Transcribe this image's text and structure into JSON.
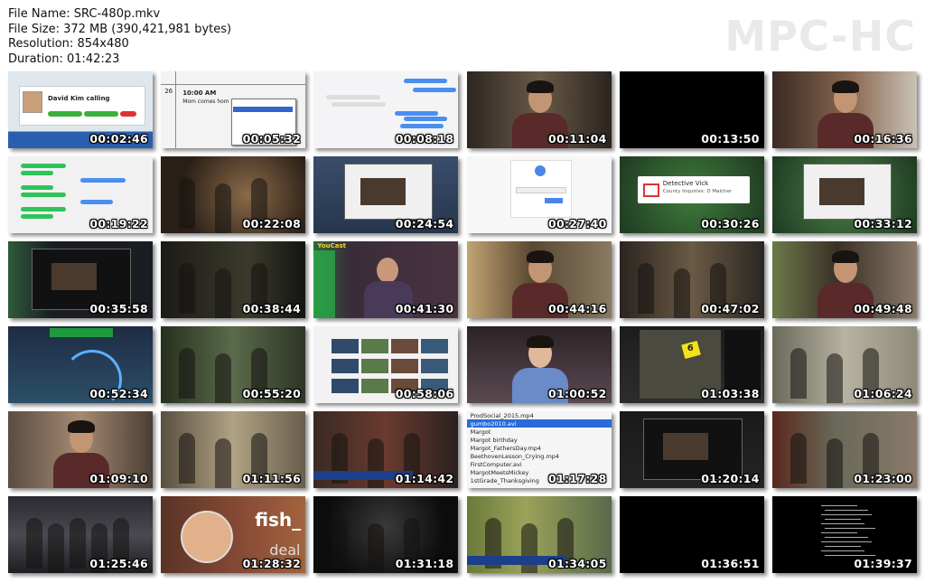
{
  "header": {
    "file_name": "File Name: SRC-480p.mkv",
    "file_size": "File Size: 372 MB (390,421,981 bytes)",
    "resolution": "Resolution: 854x480",
    "duration": "Duration: 01:42:23"
  },
  "brand": "MPC-HC",
  "thumbnails": [
    {
      "time": "00:02:46",
      "scene": "david-kim-calling",
      "caption": "David Kim calling"
    },
    {
      "time": "00:05:32",
      "scene": "calendar-menu",
      "caption": "10:00 AM",
      "caption2": "Mom comes hom",
      "day": "26"
    },
    {
      "time": "00:08:18",
      "scene": "messages-white"
    },
    {
      "time": "00:11:04",
      "scene": "facetime-man"
    },
    {
      "time": "00:13:50",
      "scene": "black"
    },
    {
      "time": "00:16:36",
      "scene": "man-phone-window"
    },
    {
      "time": "00:19:22",
      "scene": "messages-green"
    },
    {
      "time": "00:22:08",
      "scene": "bedroom-dark"
    },
    {
      "time": "00:24:54",
      "scene": "desktop-video"
    },
    {
      "time": "00:27:40",
      "scene": "google-login"
    },
    {
      "time": "00:30:26",
      "scene": "gmail-notify",
      "caption": "Detective Vick",
      "caption2": "County Inquiries: D Malcher"
    },
    {
      "time": "00:33:12",
      "scene": "desktop-piano"
    },
    {
      "time": "00:35:58",
      "scene": "desktop-dark-video"
    },
    {
      "time": "00:38:44",
      "scene": "dark-room"
    },
    {
      "time": "00:41:30",
      "scene": "youcast-boy",
      "caption": "YouCast"
    },
    {
      "time": "00:44:16",
      "scene": "girl-webcam"
    },
    {
      "time": "00:47:02",
      "scene": "room-figures"
    },
    {
      "time": "00:49:48",
      "scene": "man-smiling"
    },
    {
      "time": "00:52:34",
      "scene": "map-nav"
    },
    {
      "time": "00:55:20",
      "scene": "police-forest"
    },
    {
      "time": "00:58:06",
      "scene": "video-grid"
    },
    {
      "time": "01:00:52",
      "scene": "woman-video"
    },
    {
      "time": "01:03:38",
      "scene": "map-evidence",
      "caption": "6"
    },
    {
      "time": "01:06:24",
      "scene": "kitchen"
    },
    {
      "time": "01:09:10",
      "scene": "man-closeup"
    },
    {
      "time": "01:11:56",
      "scene": "living-room"
    },
    {
      "time": "01:14:42",
      "scene": "news-conference"
    },
    {
      "time": "01:17:28",
      "scene": "file-list",
      "files": [
        "ProdSocial_2015.mp4",
        "gumbo2010.avi",
        "Margot",
        "Margot birthday",
        "Margot_FathersDay.mp4",
        "BeethovenLesson_Crying.mp4",
        "FirstComputer.avi",
        "MargotMeetsMickey",
        "1stGrade_Thanksgiving"
      ]
    },
    {
      "time": "01:20:14",
      "scene": "desktop-dark-mosaic"
    },
    {
      "time": "01:23:00",
      "scene": "construction-men"
    },
    {
      "time": "01:25:46",
      "scene": "church"
    },
    {
      "time": "01:28:32",
      "scene": "fish-deal",
      "caption": "fish_",
      "caption2": "deal"
    },
    {
      "time": "01:31:18",
      "scene": "interrogation"
    },
    {
      "time": "01:34:05",
      "scene": "rescue-news"
    },
    {
      "time": "01:36:51",
      "scene": "black"
    },
    {
      "time": "01:39:37",
      "scene": "credits"
    }
  ]
}
